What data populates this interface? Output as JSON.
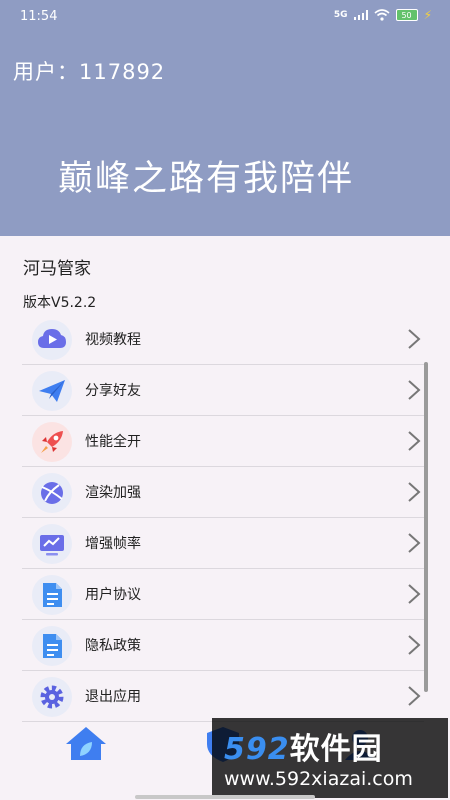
{
  "status_bar": {
    "time": "11:54",
    "signal": "5G",
    "battery": "50"
  },
  "header": {
    "user_label": "用户：",
    "user_id": "117892",
    "slogan": "巅峰之路有我陪伴"
  },
  "app": {
    "name": "河马管家",
    "version": "版本V5.2.2"
  },
  "menu": [
    {
      "label": "视频教程",
      "icon": "video-cloud-icon"
    },
    {
      "label": "分享好友",
      "icon": "paper-plane-icon"
    },
    {
      "label": "性能全开",
      "icon": "rocket-icon"
    },
    {
      "label": "渲染加强",
      "icon": "planet-icon"
    },
    {
      "label": "增强帧率",
      "icon": "monitor-icon"
    },
    {
      "label": "用户协议",
      "icon": "document-icon"
    },
    {
      "label": "隐私政策",
      "icon": "document-icon"
    },
    {
      "label": "退出应用",
      "icon": "gear-icon"
    }
  ],
  "watermark": {
    "logo_num": "592",
    "logo_text": "软件园",
    "url": "www.592xiazai.com"
  },
  "colors": {
    "header_bg": "#8f9cc3",
    "page_bg": "#f7f2f7",
    "icon_blue": "#4a7cf0"
  }
}
